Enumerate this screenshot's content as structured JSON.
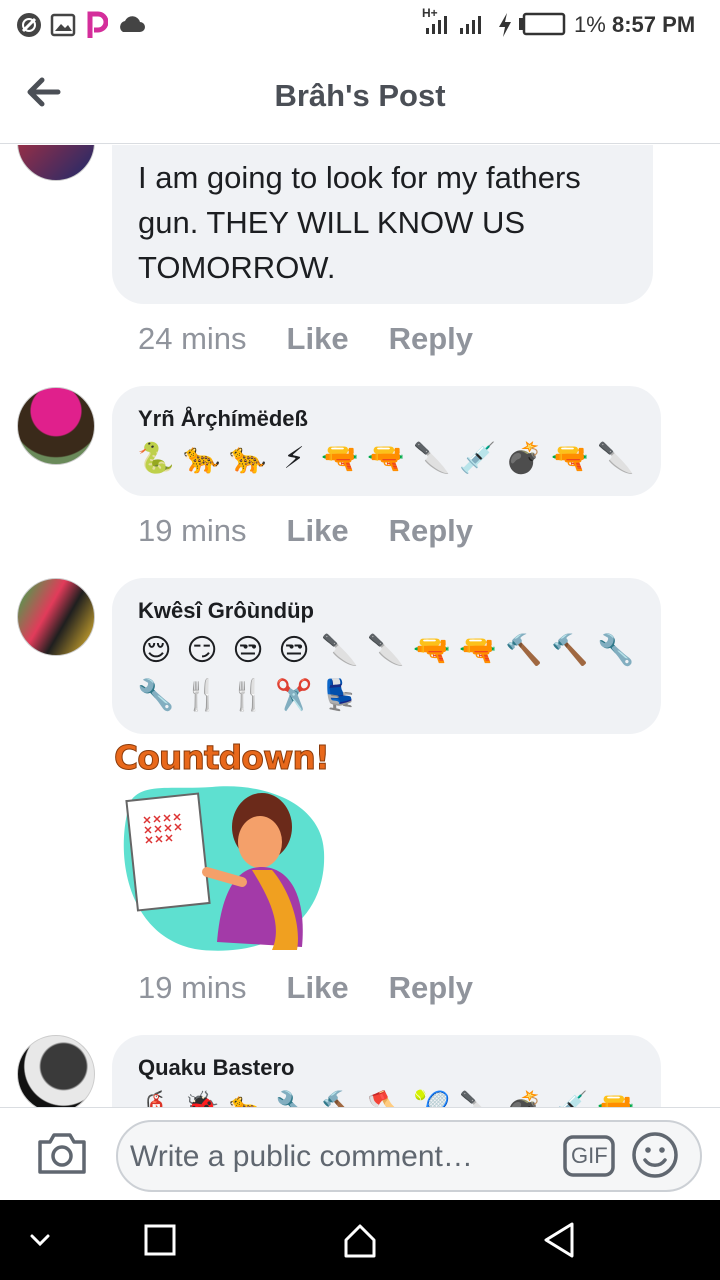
{
  "status_bar": {
    "network_label": "H+",
    "battery_percent": "1%",
    "time": "8:57 PM",
    "icons": [
      "blocked-icon",
      "image-icon",
      "picsart-icon",
      "cloud-icon",
      "signal-icon",
      "charging-icon",
      "battery-icon"
    ]
  },
  "header": {
    "title": "Brâh's Post",
    "back_icon": "arrow-left-icon"
  },
  "comments": [
    {
      "author": "",
      "text_lines": [
        "I am going to look for my fathers",
        "gun. THEY WILL KNOW US",
        "TOMORROW."
      ],
      "time": "24 mins",
      "like_label": "Like",
      "reply_label": "Reply"
    },
    {
      "author": "Yrñ Årçhímëdeß",
      "emojis": [
        "🐍",
        "🐆",
        "🐆",
        "⚡",
        "🔫",
        "🔫",
        "🔪",
        "💉",
        "💣",
        "🔫",
        "🔪"
      ],
      "time": "19 mins",
      "like_label": "Like",
      "reply_label": "Reply"
    },
    {
      "author": "Kwêsî Grôùndüp",
      "emojis_line1": [
        "😌",
        "😏",
        "😒",
        "😒",
        "🔪",
        "🔪",
        "🔫",
        "🔫",
        "🔨",
        "🔨",
        "🔧"
      ],
      "emojis_line2": [
        "🔧",
        "🍴",
        "🍴",
        "✂️",
        "💺"
      ],
      "sticker_text": "Countdown!",
      "time": "19 mins",
      "like_label": "Like",
      "reply_label": "Reply"
    },
    {
      "author": "Quaku Bastero",
      "emojis": [
        "🧯",
        "🐞",
        "🐆",
        "🔧",
        "🔨",
        "🪓",
        "🎾",
        "🔪",
        "💣",
        "💉",
        "🔫"
      ]
    }
  ],
  "composer": {
    "placeholder": "Write a public comment…",
    "gif_label": "GIF",
    "camera_icon": "camera-icon",
    "emoji_icon": "smiley-icon"
  },
  "navbar": {
    "icons": [
      "chevron-down-icon",
      "recents-square-icon",
      "home-icon",
      "back-triangle-icon"
    ]
  },
  "colors": {
    "bubble": "#f0f2f5",
    "meta_text": "#90949c",
    "header_text": "#4b4f56",
    "sticker_orange": "#e8681b",
    "sticker_teal": "#5ee0d0"
  }
}
